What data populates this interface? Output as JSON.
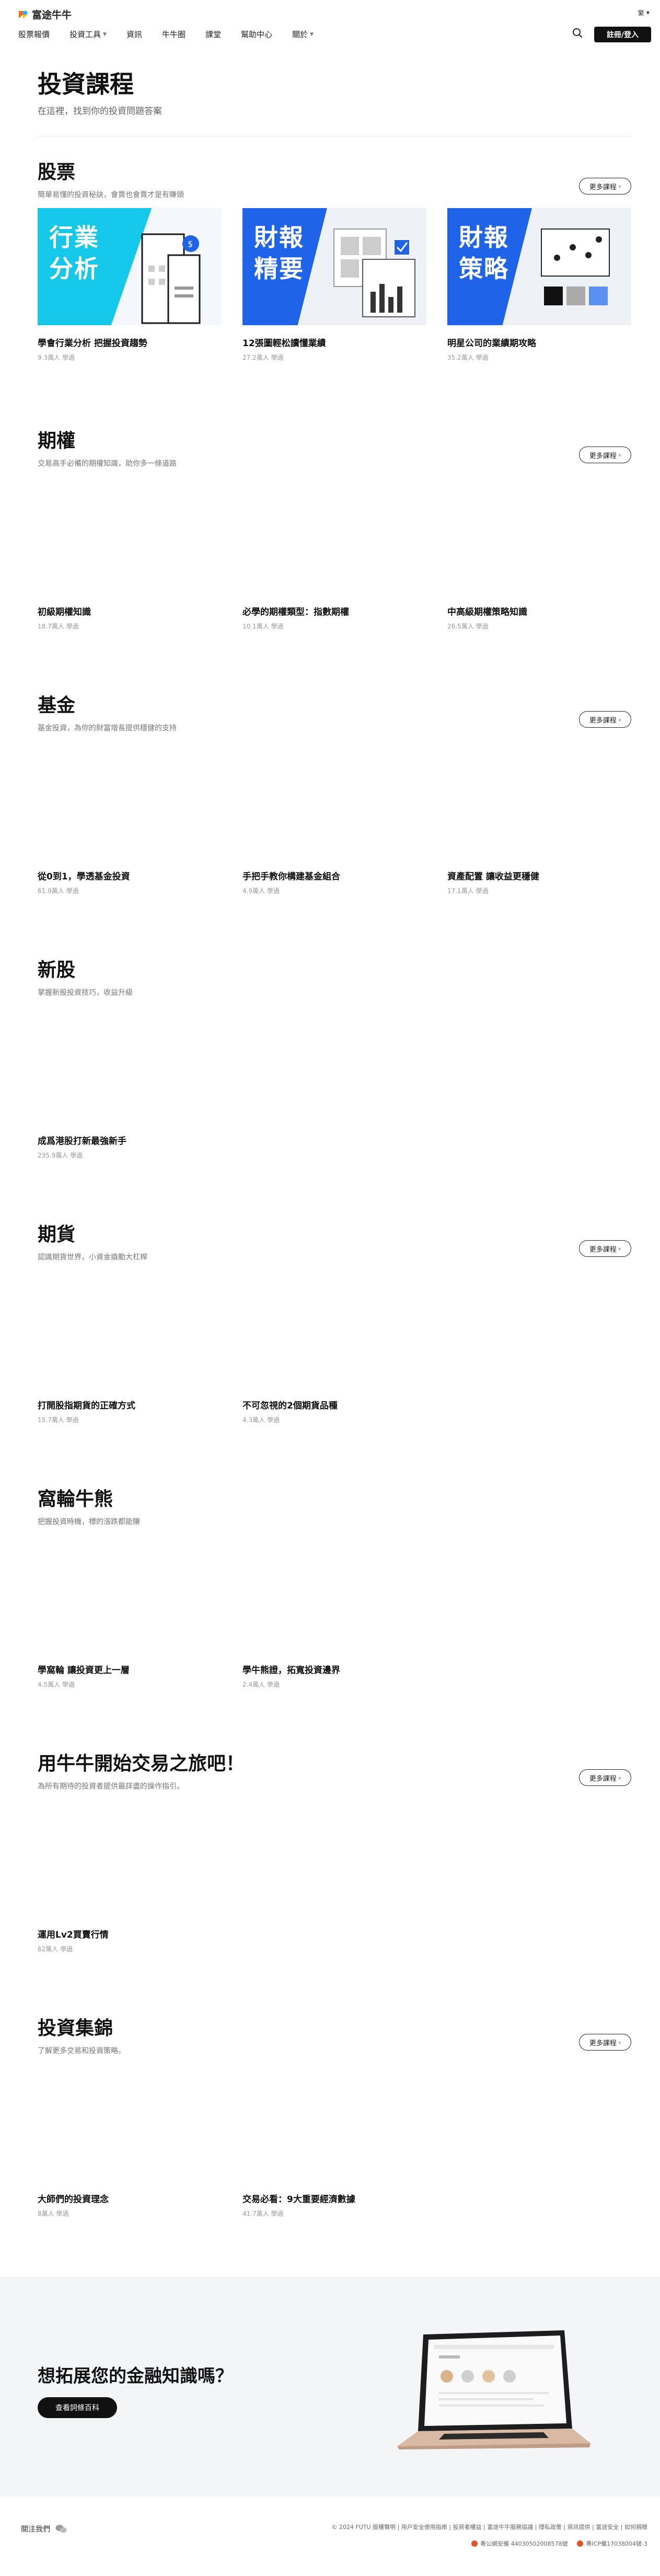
{
  "header": {
    "logo_text": "富途牛牛",
    "lang": "繁",
    "nav": [
      "股票報價",
      "投資工具",
      "資訊",
      "牛牛圈",
      "課堂",
      "幫助中心",
      "關於"
    ],
    "nav_dropdown": [
      false,
      true,
      false,
      false,
      false,
      false,
      true
    ],
    "login_label": "註冊/登入"
  },
  "hero": {
    "title": "投資課程",
    "subtitle": "在這裡，找到你的投資問題答案"
  },
  "more_label": "更多課程",
  "sections": [
    {
      "title": "股票",
      "desc": "簡單易懂的投資秘訣，會買也會賣才是有賺頭",
      "cards": [
        {
          "title": "學會行業分析 把握投資趨勢",
          "meta": "9.3萬人 學過",
          "art": "行業分析"
        },
        {
          "title": "12張圖輕松讀懂業績",
          "meta": "27.2萬人 學過",
          "art": "財報精要"
        },
        {
          "title": "明星公司的業績期攻略",
          "meta": "35.2萬人 學過",
          "art": "財報策略"
        }
      ]
    },
    {
      "title": "期權",
      "desc": "交易高手必備的期權知識，助你多一條道路",
      "cards": [
        {
          "title": "初級期權知識",
          "meta": "18.7萬人 學過"
        },
        {
          "title": "必學的期權類型：指數期權",
          "meta": "10.1萬人 學過"
        },
        {
          "title": "中高級期權策略知識",
          "meta": "26.5萬人 學過"
        }
      ]
    },
    {
      "title": "基金",
      "desc": "基金投資，為你的財富增長提供穩健的支持",
      "cards": [
        {
          "title": "從0到1，學透基金投資",
          "meta": "61.9萬人 學過"
        },
        {
          "title": "手把手教你構建基金組合",
          "meta": "4.9萬人 學過"
        },
        {
          "title": "資產配置 讓收益更穩健",
          "meta": "17.1萬人 學過"
        }
      ]
    },
    {
      "title": "新股",
      "desc": "掌握新股投資技巧，收益升級",
      "cards": [
        {
          "title": "成爲港股打新最強新手",
          "meta": "235.9萬人 學過"
        }
      ]
    },
    {
      "title": "期貨",
      "desc": "認識期貨世界，小資金撬動大杠桿",
      "cards": [
        {
          "title": "打開股指期貨的正確方式",
          "meta": "15.7萬人 學過"
        },
        {
          "title": "不可忽視的2個期貨品種",
          "meta": "4.3萬人 學過"
        }
      ]
    },
    {
      "title": "窩輪牛熊",
      "desc": "把握投資時機，標的漲跌都能賺",
      "cards": [
        {
          "title": "學窩輪 讓投資更上一層",
          "meta": "4.5萬人 學過"
        },
        {
          "title": "學牛熊證，拓寬投資邊界",
          "meta": "2.4萬人 學過"
        }
      ]
    },
    {
      "title": "用牛牛開始交易之旅吧！",
      "desc": "為所有期待的投資者提供最詳盡的操作指引。",
      "cards": [
        {
          "title": "運用Lv2買賣行情",
          "meta": "62萬人 學過"
        }
      ]
    },
    {
      "title": "投資集錦",
      "desc": "了解更多交易和投資策略。",
      "cards": [
        {
          "title": "大師們的投資理念",
          "meta": "8萬人 學過"
        },
        {
          "title": "交易必看：9大重要經濟數據",
          "meta": "41.7萬人 學過"
        }
      ]
    }
  ],
  "cta": {
    "title": "想拓展您的金融知識嗎？",
    "button": "查看詞條百科"
  },
  "footer": {
    "follow": "關注我們",
    "links": "© 2024 FUTU 版權聲明 | 用戶安全使用指南 | 投資者權益 | 富途牛牛服務協議 | 隱私政策 | 資訊提供 | 富途安全 | 如何捐贈",
    "lic1": "粵公網安備 44030502008578號",
    "lic2": "粵ICP備17038004號-3"
  },
  "colors": {
    "accent_cyan": "#15c8ea",
    "accent_blue": "#1f63e8",
    "dark_button": "#111111"
  }
}
